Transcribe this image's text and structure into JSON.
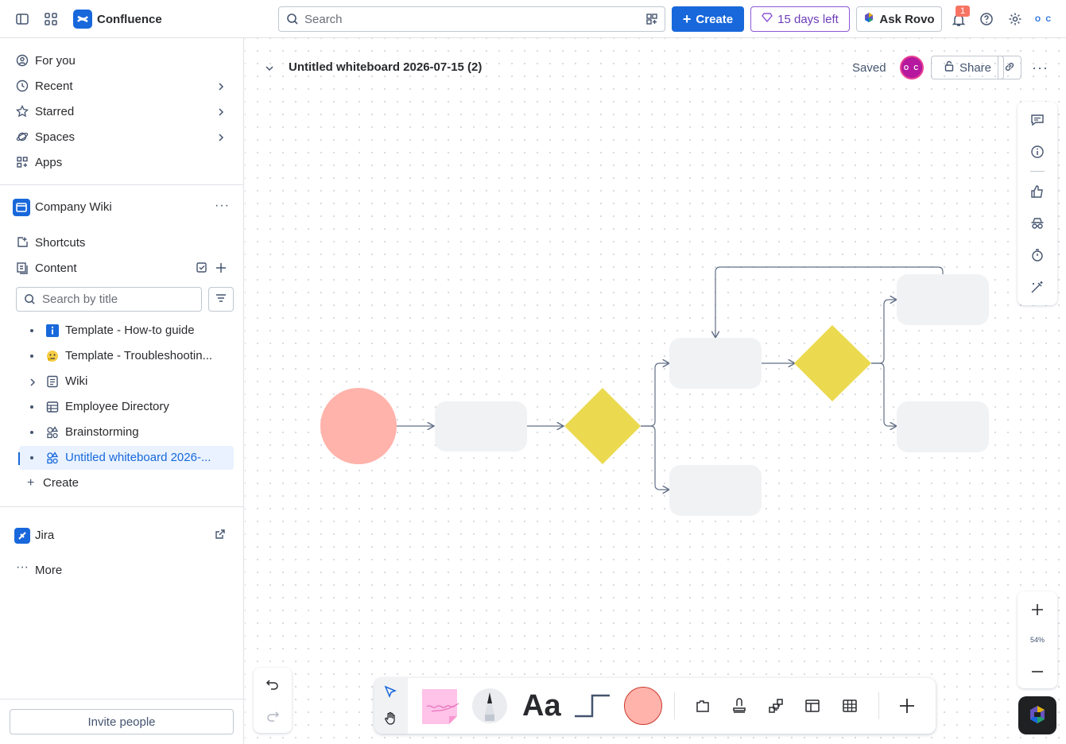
{
  "topbar": {
    "app_name": "Confluence",
    "search_placeholder": "Search",
    "create_label": "Create",
    "trial_label": "15 days left",
    "rovo_label": "Ask Rovo",
    "notification_count": "1",
    "avatar_initials": "O C"
  },
  "sidebar": {
    "nav": [
      {
        "label": "For you"
      },
      {
        "label": "Recent"
      },
      {
        "label": "Starred"
      },
      {
        "label": "Spaces"
      },
      {
        "label": "Apps"
      }
    ],
    "space_name": "Company Wiki",
    "shortcuts_label": "Shortcuts",
    "content_label": "Content",
    "search_placeholder": "Search by title",
    "tree": [
      {
        "label": "Template - How-to guide"
      },
      {
        "label": "Template - Troubleshootin..."
      },
      {
        "label": "Wiki"
      },
      {
        "label": "Employee Directory"
      },
      {
        "label": "Brainstorming"
      },
      {
        "label": "Untitled whiteboard 2026-..."
      }
    ],
    "create_label": "Create",
    "jira_label": "Jira",
    "more_label": "More",
    "invite_label": "Invite people"
  },
  "whiteboard": {
    "title": "Untitled whiteboard 2026-07-15 (2)",
    "status": "Saved",
    "share_label": "Share",
    "avatar_initials": "O C",
    "zoom": "54%"
  },
  "colors": {
    "brand_blue": "#1868DB",
    "circle_fill": "#FFB3AB",
    "diamond_fill": "#EBDA50",
    "box_fill": "#F1F2F4",
    "sticky_fill": "#FFC2E8"
  }
}
